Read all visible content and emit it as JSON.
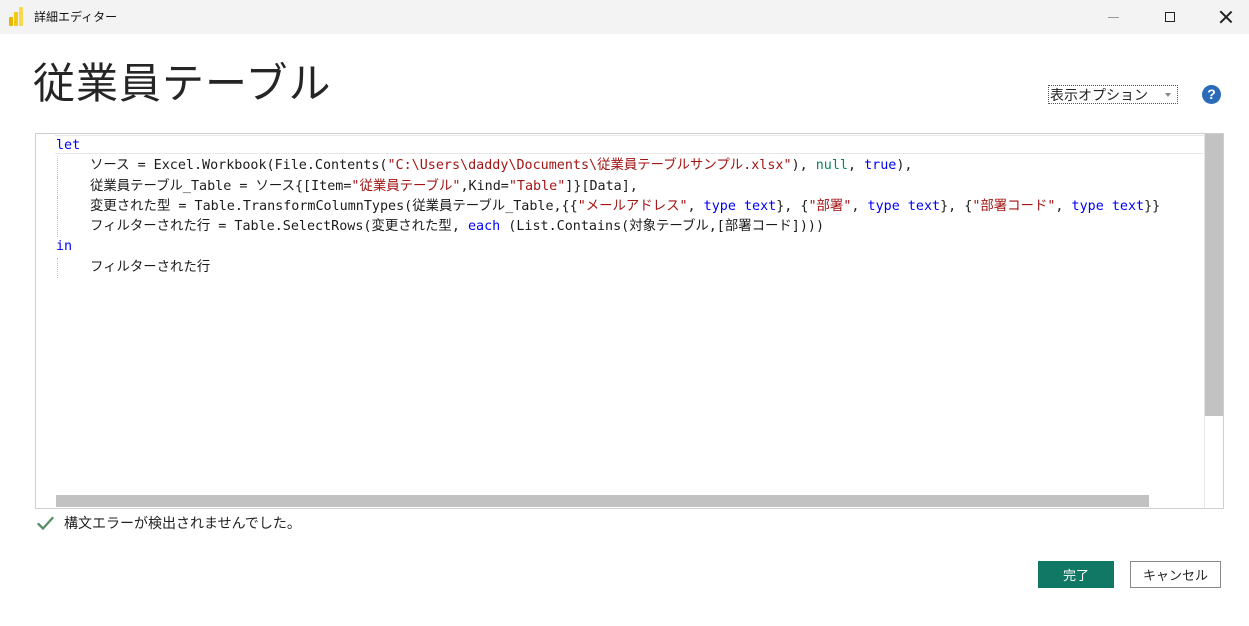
{
  "window": {
    "title": "詳細エディター",
    "controls": {
      "minimize": "minimize",
      "maximize": "maximize",
      "close": "close"
    }
  },
  "header": {
    "query_name": "従業員テーブル",
    "display_options_label": "表示オプション",
    "help_symbol": "?"
  },
  "editor": {
    "lines": [
      {
        "indent": false,
        "tokens": [
          {
            "t": "let",
            "c": "kw"
          }
        ]
      },
      {
        "indent": true,
        "tokens": [
          {
            "t": "ソース = Excel.Workbook(File.Contents(",
            "c": ""
          },
          {
            "t": "\"C:\\Users\\daddy\\Documents\\従業員テーブルサンプル.xlsx\"",
            "c": "str"
          },
          {
            "t": "), ",
            "c": ""
          },
          {
            "t": "null",
            "c": "lit"
          },
          {
            "t": ", ",
            "c": ""
          },
          {
            "t": "true",
            "c": "kw"
          },
          {
            "t": "),",
            "c": ""
          }
        ]
      },
      {
        "indent": true,
        "tokens": [
          {
            "t": "従業員テーブル_Table = ソース{[Item=",
            "c": ""
          },
          {
            "t": "\"従業員テーブル\"",
            "c": "str"
          },
          {
            "t": ",Kind=",
            "c": ""
          },
          {
            "t": "\"Table\"",
            "c": "str"
          },
          {
            "t": "]}[Data],",
            "c": ""
          }
        ]
      },
      {
        "indent": true,
        "tokens": [
          {
            "t": "変更された型 = Table.TransformColumnTypes(従業員テーブル_Table,{{",
            "c": ""
          },
          {
            "t": "\"メールアドレス\"",
            "c": "str"
          },
          {
            "t": ", ",
            "c": ""
          },
          {
            "t": "type",
            "c": "kw"
          },
          {
            "t": " ",
            "c": ""
          },
          {
            "t": "text",
            "c": "kw"
          },
          {
            "t": "}, {",
            "c": ""
          },
          {
            "t": "\"部署\"",
            "c": "str"
          },
          {
            "t": ", ",
            "c": ""
          },
          {
            "t": "type",
            "c": "kw"
          },
          {
            "t": " ",
            "c": ""
          },
          {
            "t": "text",
            "c": "kw"
          },
          {
            "t": "}, {",
            "c": ""
          },
          {
            "t": "\"部署コード\"",
            "c": "str"
          },
          {
            "t": ", ",
            "c": ""
          },
          {
            "t": "type",
            "c": "kw"
          },
          {
            "t": " ",
            "c": ""
          },
          {
            "t": "text",
            "c": "kw"
          },
          {
            "t": "}}",
            "c": ""
          }
        ]
      },
      {
        "indent": true,
        "tokens": [
          {
            "t": "フィルターされた行 = Table.SelectRows(変更された型, ",
            "c": ""
          },
          {
            "t": "each",
            "c": "kw"
          },
          {
            "t": " (List.Contains(対象テーブル,[部署コード])))",
            "c": ""
          }
        ]
      },
      {
        "indent": false,
        "tokens": [
          {
            "t": "in",
            "c": "kw"
          }
        ]
      },
      {
        "indent": true,
        "tokens": [
          {
            "t": "フィルターされた行",
            "c": ""
          }
        ]
      }
    ]
  },
  "status": {
    "icon": "check-icon",
    "message": "構文エラーが検出されませんでした。"
  },
  "footer": {
    "done_label": "完了",
    "cancel_label": "キャンセル"
  },
  "colors": {
    "primary_button": "#117865",
    "keyword": "#0000ff",
    "string": "#a31515",
    "literal": "#09885a",
    "check": "#5a8f6a"
  }
}
